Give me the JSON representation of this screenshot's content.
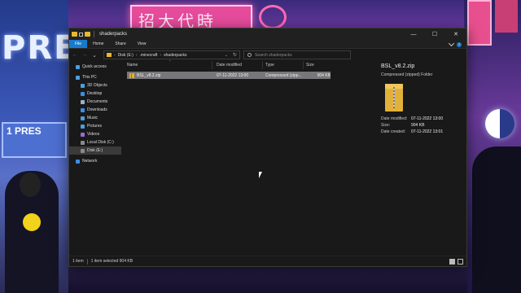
{
  "window": {
    "title": "shaderpacks",
    "controls": {
      "minimize": "—",
      "maximize": "☐",
      "close": "✕"
    }
  },
  "ribbon": {
    "tabs": [
      "File",
      "Home",
      "Share",
      "View"
    ],
    "expand_glyph": "⌄",
    "help_glyph": "?"
  },
  "navigation": {
    "back": "←",
    "forward": "→",
    "recent": "⌄",
    "up": "↑",
    "breadcrumb": [
      "Disk (E:)",
      ".minecraft",
      "shaderpacks"
    ],
    "crumb_separator": "›",
    "address_dropdown": "⌄",
    "refresh": "↻",
    "search_placeholder": "Search shaderpacks"
  },
  "sidebar": {
    "items": [
      {
        "label": "Quick access",
        "icon": "star-icon",
        "color": "#4a9fe0"
      },
      {
        "label": "This PC",
        "icon": "pc-icon",
        "color": "#4a9fe0"
      },
      {
        "label": "3D Objects",
        "icon": "cube-icon",
        "color": "#4a9fe0"
      },
      {
        "label": "Desktop",
        "icon": "desktop-icon",
        "color": "#3a8ee6"
      },
      {
        "label": "Documents",
        "icon": "document-icon",
        "color": "#9bb0c8"
      },
      {
        "label": "Downloads",
        "icon": "download-icon",
        "color": "#3a8ee6"
      },
      {
        "label": "Music",
        "icon": "music-icon",
        "color": "#4aa0e0"
      },
      {
        "label": "Pictures",
        "icon": "pictures-icon",
        "color": "#4aa0e0"
      },
      {
        "label": "Videos",
        "icon": "video-icon",
        "color": "#9a6ad0"
      },
      {
        "label": "Local Disk (C:)",
        "icon": "drive-icon",
        "color": "#8a8a8a"
      },
      {
        "label": "Disk (E:)",
        "icon": "drive-icon",
        "color": "#8a8a8a"
      },
      {
        "label": "Network",
        "icon": "network-icon",
        "color": "#3a8ee6"
      }
    ]
  },
  "columns": [
    "Name",
    "Date modified",
    "Type",
    "Size"
  ],
  "files": [
    {
      "name": "BSL_v8.2.zip",
      "date": "07-11-2022 13:00",
      "type": "Compressed (zipp...",
      "size": "904 KB"
    }
  ],
  "preview": {
    "name": "BSL_v8.2.zip",
    "type": "Compressed (zipped) Folder",
    "meta": [
      {
        "label": "Date modified:",
        "value": "07-11-2022 13:00"
      },
      {
        "label": "Size:",
        "value": "904 KB"
      },
      {
        "label": "Date created:",
        "value": "07-11-2022 13:01"
      }
    ]
  },
  "status": {
    "count": "1 item",
    "selection": "1 item selected  904 KB"
  },
  "colors": {
    "accent": "#1979ca",
    "window_bg": "#191919",
    "selected_row": "#77777a",
    "zip_folder": "#e3b13a"
  }
}
